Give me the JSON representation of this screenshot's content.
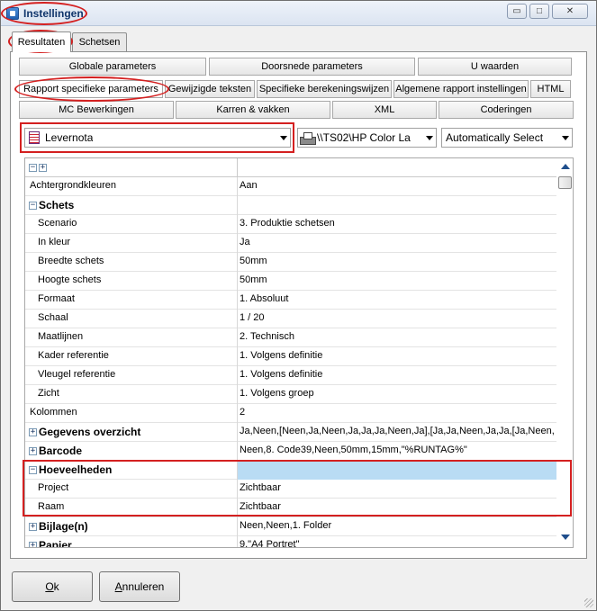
{
  "window": {
    "title": "Instellingen",
    "controls": {
      "minimize": "▭",
      "maximize": "□",
      "close": "✕"
    }
  },
  "tabs": [
    {
      "label": "Resultaten",
      "active": true
    },
    {
      "label": "Schetsen",
      "active": false
    }
  ],
  "categories": {
    "row1": [
      "Globale parameters",
      "Doorsnede parameters",
      "U waarden"
    ],
    "row2": [
      "Rapport specifieke parameters",
      "Gewijzigde teksten",
      "Specifieke berekeningswijzen",
      "Algemene rapport instellingen",
      "HTML"
    ],
    "row3": [
      "MC Bewerkingen",
      "Karren & vakken",
      "XML",
      "Coderingen"
    ]
  },
  "report_select": {
    "value": "Levernota",
    "icon": "document-icon"
  },
  "printer_select": {
    "value": "\\\\TS02\\HP Color La",
    "icon": "printer-icon"
  },
  "tray_select": {
    "value": "Automatically Select"
  },
  "grid": {
    "header_toggles": {
      "collapse": "−",
      "expand": "+"
    },
    "rows": [
      {
        "name": "Achtergrondkleuren",
        "value": "Aan",
        "level": 0,
        "group": false,
        "toggle": ""
      },
      {
        "name": "Schets",
        "value": "",
        "level": 0,
        "group": true,
        "toggle": "−"
      },
      {
        "name": "Scenario",
        "value": "3. Produktie schetsen",
        "level": 1,
        "group": false,
        "toggle": ""
      },
      {
        "name": "In kleur",
        "value": "Ja",
        "level": 1,
        "group": false,
        "toggle": ""
      },
      {
        "name": "Breedte schets",
        "value": "50mm",
        "level": 1,
        "group": false,
        "toggle": ""
      },
      {
        "name": "Hoogte schets",
        "value": "50mm",
        "level": 1,
        "group": false,
        "toggle": ""
      },
      {
        "name": "Formaat",
        "value": "1. Absoluut",
        "level": 1,
        "group": false,
        "toggle": ""
      },
      {
        "name": "Schaal",
        "value": "1 / 20",
        "level": 1,
        "group": false,
        "toggle": ""
      },
      {
        "name": "Maatlijnen",
        "value": "2. Technisch",
        "level": 1,
        "group": false,
        "toggle": ""
      },
      {
        "name": "Kader referentie",
        "value": "1. Volgens definitie",
        "level": 1,
        "group": false,
        "toggle": ""
      },
      {
        "name": "Vleugel referentie",
        "value": "1. Volgens definitie",
        "level": 1,
        "group": false,
        "toggle": ""
      },
      {
        "name": "Zicht",
        "value": "1. Volgens groep",
        "level": 1,
        "group": false,
        "toggle": ""
      },
      {
        "name": "Kolommen",
        "value": "2",
        "level": 0,
        "group": false,
        "toggle": ""
      },
      {
        "name": "Gegevens overzicht",
        "value": "Ja,Neen,[Neen,Ja,Neen,Ja,Ja,Ja,Neen,Ja],[Ja,Ja,Neen,Ja,Ja,[Ja,Neen,Ne",
        "level": 0,
        "group": true,
        "toggle": "+"
      },
      {
        "name": "Barcode",
        "value": "Neen,8. Code39,Neen,50mm,15mm,\"%RUNTAG%\"",
        "level": 0,
        "group": true,
        "toggle": "+"
      },
      {
        "name": "Hoeveelheden",
        "value": "",
        "level": 0,
        "group": true,
        "toggle": "−",
        "highlight": true
      },
      {
        "name": "Project",
        "value": "Zichtbaar",
        "level": 1,
        "group": false,
        "toggle": ""
      },
      {
        "name": "Raam",
        "value": "Zichtbaar",
        "level": 1,
        "group": false,
        "toggle": ""
      },
      {
        "name": "Bijlage(n)",
        "value": "Neen,Neen,1. Folder",
        "level": 0,
        "group": true,
        "toggle": "+"
      },
      {
        "name": "Papier",
        "value": "9.\"A4 Portret\"",
        "level": 0,
        "group": true,
        "toggle": "+"
      }
    ]
  },
  "footer": {
    "ok": {
      "accel": "O",
      "rest": "k"
    },
    "cancel": {
      "accel": "A",
      "rest": "nnuleren"
    }
  },
  "colors": {
    "annotation": "#d42020",
    "selection": "#b9dcf4"
  }
}
